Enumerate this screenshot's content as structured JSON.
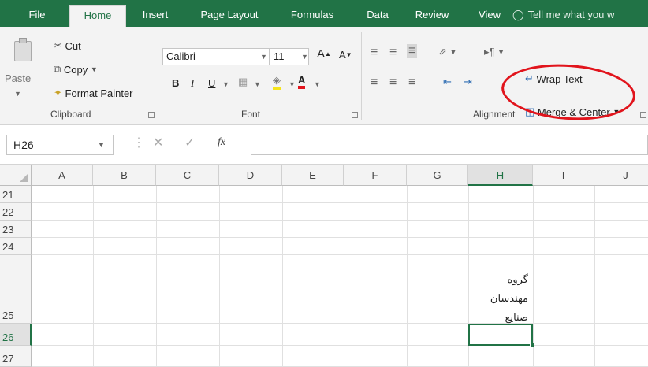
{
  "ribbon_tabs": {
    "file": "File",
    "home": "Home",
    "insert": "Insert",
    "page_layout": "Page Layout",
    "formulas": "Formulas",
    "data": "Data",
    "review": "Review",
    "view": "View",
    "tell_me": "Tell me what you w"
  },
  "clipboard": {
    "paste": "Paste",
    "cut": "Cut",
    "copy": "Copy",
    "format_painter": "Format Painter",
    "group_label": "Clipboard"
  },
  "font": {
    "font_name": "Calibri",
    "font_size": "11",
    "bold": "B",
    "italic": "I",
    "underline": "U",
    "group_label": "Font"
  },
  "alignment": {
    "wrap_text": "Wrap Text",
    "merge_center": "Merge & Center",
    "group_label": "Alignment"
  },
  "formula_bar": {
    "name_box": "H26",
    "fx": "fx",
    "formula": ""
  },
  "grid": {
    "columns": [
      "A",
      "B",
      "C",
      "D",
      "E",
      "F",
      "G",
      "H",
      "I",
      "J"
    ],
    "selected_column": "H",
    "rows": [
      "21",
      "22",
      "23",
      "24",
      "25",
      "26",
      "27"
    ],
    "selected_row": "26",
    "cell_h25_lines": [
      "گروه",
      "مهندسان",
      "صنایع"
    ]
  },
  "colors": {
    "ribbon_green": "#217346",
    "annotation_red": "#e1141c"
  }
}
